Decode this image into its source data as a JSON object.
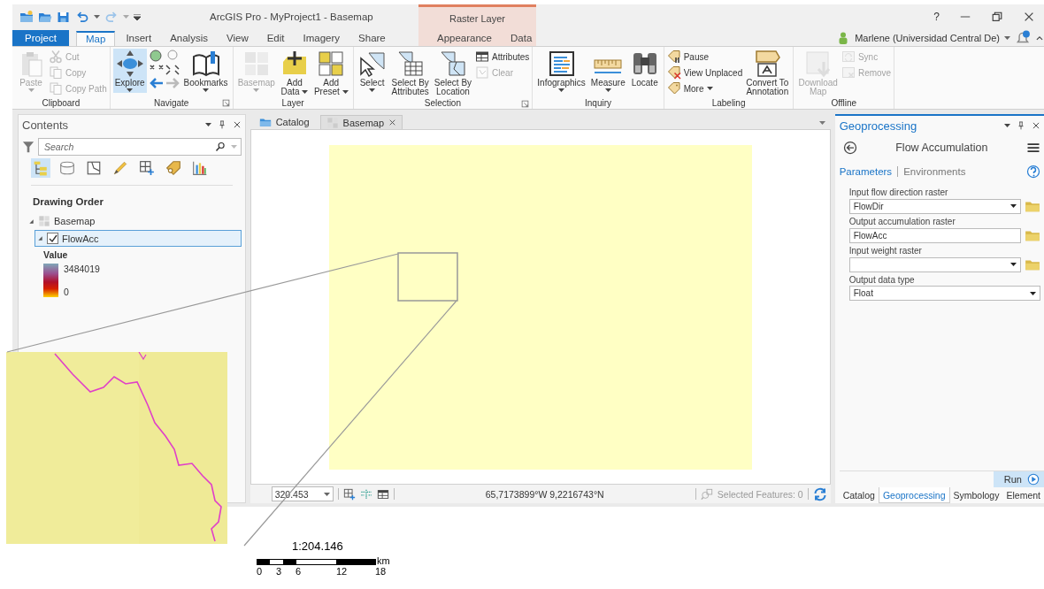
{
  "window": {
    "title": "ArcGIS Pro - MyProject1 - Basemap",
    "context_group": "Raster Layer",
    "help": "?"
  },
  "user": {
    "name": "Marlene (Universidad Central De)"
  },
  "ribbon_tabs": [
    {
      "label": "Project",
      "kind": "backstage",
      "selected": false
    },
    {
      "label": "Map",
      "kind": "normal",
      "selected": true
    },
    {
      "label": "Insert",
      "kind": "normal",
      "selected": false
    },
    {
      "label": "Analysis",
      "kind": "normal",
      "selected": false
    },
    {
      "label": "View",
      "kind": "normal",
      "selected": false
    },
    {
      "label": "Edit",
      "kind": "normal",
      "selected": false
    },
    {
      "label": "Imagery",
      "kind": "normal",
      "selected": false
    },
    {
      "label": "Share",
      "kind": "normal",
      "selected": false
    },
    {
      "label": "Appearance",
      "kind": "contextual",
      "selected": false
    },
    {
      "label": "Data",
      "kind": "contextual",
      "selected": false
    }
  ],
  "ribbon_groups": [
    {
      "title": "Clipboard",
      "items": [
        {
          "kind": "large",
          "label": "Paste",
          "disabled": true,
          "selected": false,
          "dropdown": true
        },
        {
          "kind": "stack",
          "items": [
            {
              "label": "Cut",
              "disabled": true
            },
            {
              "label": "Copy",
              "disabled": true
            },
            {
              "label": "Copy Path",
              "disabled": true
            }
          ]
        }
      ]
    },
    {
      "title": "Navigate",
      "launcher": true,
      "items": [
        {
          "kind": "large",
          "label": "Explore",
          "disabled": false,
          "selected": true,
          "dropdown": true
        },
        {
          "kind": "tools"
        },
        {
          "kind": "large",
          "label": "Bookmarks",
          "disabled": false,
          "selected": false,
          "dropdown": true
        }
      ]
    },
    {
      "title": "Layer",
      "items": [
        {
          "kind": "large",
          "label": "Basemap",
          "disabled": true,
          "selected": false,
          "dropdown": true
        },
        {
          "kind": "split",
          "label": "Add\nData",
          "disabled": false,
          "selected": false,
          "dropdown": true
        },
        {
          "kind": "split",
          "label": "Add\nPreset",
          "disabled": false,
          "selected": false,
          "dropdown": true
        }
      ]
    },
    {
      "title": "Selection",
      "launcher": true,
      "items": [
        {
          "kind": "large",
          "label": "Select",
          "disabled": false,
          "selected": false,
          "dropdown": true
        },
        {
          "kind": "large",
          "label": "Select By\nAttributes",
          "disabled": false,
          "selected": false,
          "dropdown": false
        },
        {
          "kind": "large",
          "label": "Select By\nLocation",
          "disabled": false,
          "selected": false,
          "dropdown": false
        },
        {
          "kind": "stack",
          "items": [
            {
              "label": "Attributes",
              "disabled": false
            },
            {
              "label": "Clear",
              "disabled": true
            }
          ]
        }
      ]
    },
    {
      "title": "Inquiry",
      "items": [
        {
          "kind": "large",
          "label": "Infographics",
          "disabled": false,
          "selected": false,
          "dropdown": true
        },
        {
          "kind": "large",
          "label": "Measure",
          "disabled": false,
          "selected": false,
          "dropdown": true
        },
        {
          "kind": "large",
          "label": "Locate",
          "disabled": false,
          "selected": false,
          "dropdown": false
        }
      ]
    },
    {
      "title": "Labeling",
      "items": [
        {
          "kind": "stack",
          "items": [
            {
              "label": "Pause",
              "disabled": false,
              "dropdown": false
            },
            {
              "label": "View Unplaced",
              "disabled": false,
              "dropdown": false
            },
            {
              "label": "More",
              "disabled": false,
              "dropdown": true
            }
          ]
        },
        {
          "kind": "large",
          "label": "Convert To\nAnnotation",
          "disabled": false,
          "selected": false,
          "dropdown": false
        }
      ]
    },
    {
      "title": "Offline",
      "items": [
        {
          "kind": "large",
          "label": "Download\nMap",
          "disabled": true,
          "selected": false,
          "dropdown": false
        },
        {
          "kind": "stack",
          "items": [
            {
              "label": "Sync",
              "disabled": true
            },
            {
              "label": "Remove",
              "disabled": true
            }
          ]
        }
      ]
    }
  ],
  "contents": {
    "title": "Contents",
    "search": {
      "placeholder": "Search"
    },
    "views": [
      {
        "selected": true
      },
      {
        "selected": false
      },
      {
        "selected": false
      },
      {
        "selected": false
      },
      {
        "selected": false
      },
      {
        "selected": false
      },
      {
        "selected": false
      }
    ],
    "heading": "Drawing Order",
    "tree": [
      {
        "label": "Basemap",
        "kind": "map",
        "expanded": true,
        "children": [
          {
            "label": "FlowAcc",
            "kind": "layer",
            "expanded": true,
            "checked": true,
            "selected": true,
            "legend": {
              "heading": "Value",
              "high": "3484019",
              "low": "0"
            }
          }
        ]
      }
    ]
  },
  "map_view": {
    "tabs": [
      {
        "label": "Catalog",
        "kind": "catalog",
        "selected": false
      },
      {
        "label": "Basemap",
        "kind": "map",
        "selected": true,
        "closable": true
      }
    ],
    "status_bar": {
      "scale": "320.453",
      "coordinates": "65,7173899°W 9,2216743°N",
      "selected_features": "Selected Features: 0"
    }
  },
  "geoprocessing": {
    "title": "Geoprocessing",
    "tool": "Flow Accumulation",
    "subtabs": [
      {
        "label": "Parameters",
        "selected": true
      },
      {
        "label": "Environments",
        "selected": false
      }
    ],
    "parameters": [
      {
        "label": "Input flow direction raster",
        "value": "FlowDir",
        "dropdown": true,
        "browse": true
      },
      {
        "label": "Output accumulation raster",
        "value": "FlowAcc",
        "dropdown": false,
        "browse": true
      },
      {
        "label": "Input weight raster",
        "dropdown": true,
        "browse": true
      },
      {
        "label": "Output data type",
        "value": "Float",
        "dropdown": true,
        "browse": false
      }
    ],
    "run": "Run",
    "bottom_tabs": [
      {
        "label": "Catalog",
        "selected": false
      },
      {
        "label": "Geoprocessing",
        "selected": true
      },
      {
        "label": "Symbology",
        "selected": false
      },
      {
        "label": "Element",
        "selected": false
      }
    ]
  },
  "scale_bar": {
    "ratio": "1:204.146",
    "ticks": [
      "0",
      "3",
      "6",
      "12",
      "18"
    ],
    "unit": "km"
  }
}
